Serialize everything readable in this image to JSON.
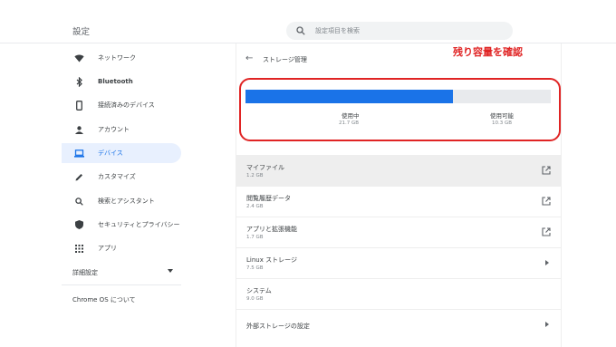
{
  "header": {
    "app_title": "設定",
    "search_placeholder": "設定項目を検索"
  },
  "sidebar": {
    "items": [
      {
        "label": "ネットワーク",
        "icon": "wifi-icon"
      },
      {
        "label": "Bluetooth",
        "icon": "bluetooth-icon"
      },
      {
        "label": "接続済みのデバイス",
        "icon": "phone-icon"
      },
      {
        "label": "アカウント",
        "icon": "person-icon"
      },
      {
        "label": "デバイス",
        "icon": "laptop-icon",
        "active": true
      },
      {
        "label": "カスタマイズ",
        "icon": "pen-icon"
      },
      {
        "label": "検索とアシスタント",
        "icon": "search-icon"
      },
      {
        "label": "セキュリティとプライバシー",
        "icon": "shield-icon"
      },
      {
        "label": "アプリ",
        "icon": "apps-grid-icon"
      }
    ],
    "advanced": "詳細設定",
    "about": "Chrome OS について"
  },
  "main": {
    "back_icon": "back-arrow-icon",
    "title": "ストレージ管理",
    "storage": {
      "used_fraction": 0.68,
      "used_label": "使用中",
      "used_value": "21.7 GB",
      "available_label": "使用可能",
      "available_value": "10.3 GB"
    },
    "rows": [
      {
        "title": "マイファイル",
        "size": "1.2 GB",
        "action": "external-link-icon",
        "selected": true
      },
      {
        "title": "閲覧履歴データ",
        "size": "2.4 GB",
        "action": "external-link-icon"
      },
      {
        "title": "アプリと拡張機能",
        "size": "1.7 GB",
        "action": "external-link-icon"
      },
      {
        "title": "Linux ストレージ",
        "size": "7.5 GB",
        "action": "chevron-right-icon"
      },
      {
        "title": "システム",
        "size": "9.0 GB",
        "action": "none"
      },
      {
        "title": "外部ストレージの設定",
        "size": "",
        "action": "chevron-right-icon"
      }
    ]
  },
  "annotation": {
    "text": "残り容量を確認",
    "color": "#e02424"
  },
  "colors": {
    "accent": "#1a73e8",
    "active_bg": "#e8f0fe",
    "bar_track": "#e8eaed"
  }
}
